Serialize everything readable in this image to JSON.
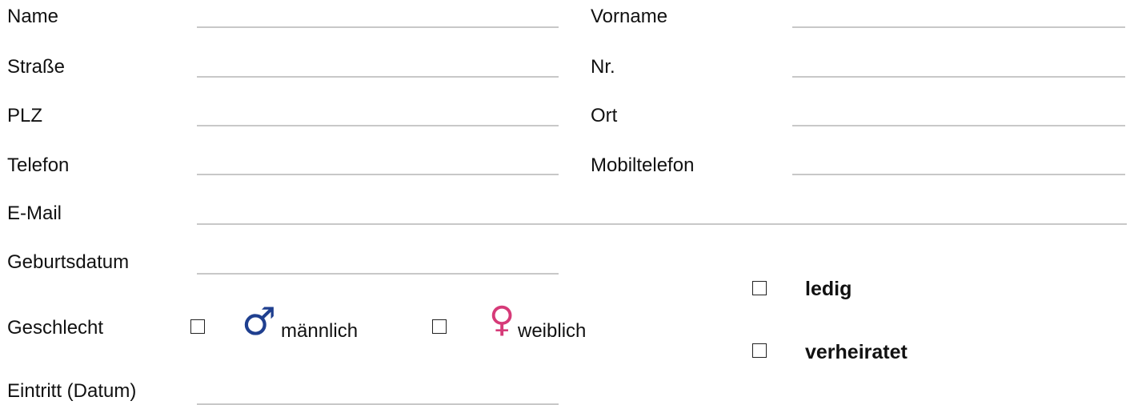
{
  "form": {
    "name_label": "Name",
    "vorname_label": "Vorname",
    "strasse_label": "Straße",
    "nr_label": "Nr.",
    "plz_label": "PLZ",
    "ort_label": "Ort",
    "telefon_label": "Telefon",
    "mobiltelefon_label": "Mobiltelefon",
    "email_label": "E-Mail",
    "geburtsdatum_label": "Geburtsdatum",
    "geschlecht_label": "Geschlecht",
    "eintritt_label": "Eintritt (Datum)",
    "maennlich_label": "männlich",
    "weiblich_label": "weiblich",
    "ledig_label": "ledig",
    "verheiratet_label": "verheiratet"
  },
  "symbols": {
    "male": "♂",
    "female": "♀",
    "male_color": "#1f3f8f",
    "female_color": "#d63a78",
    "male_icon": "male-symbol-icon",
    "female_icon": "female-symbol-icon"
  }
}
